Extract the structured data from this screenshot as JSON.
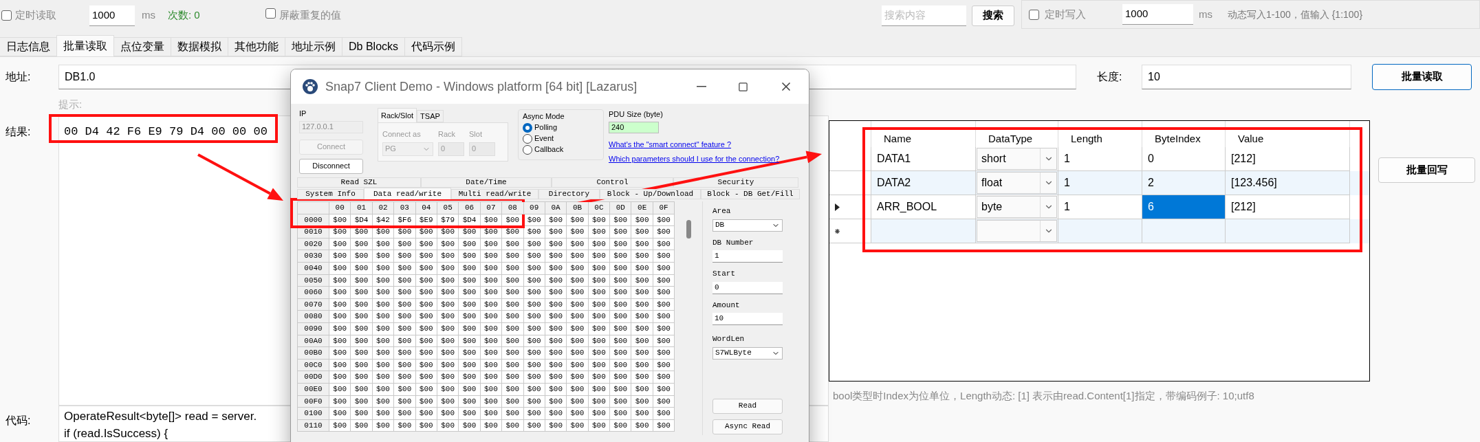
{
  "top_bar": {
    "timed_read": {
      "label": "定时读取",
      "checked": false
    },
    "interval": "1000",
    "interval_unit": "ms",
    "count": "次数: 0",
    "hide_duplicates": {
      "label": "屏蔽重复的值",
      "checked": false
    },
    "search": {
      "placeholder": "搜索内容"
    },
    "search_button": "搜索"
  },
  "write_panel": {
    "timed_write": {
      "label": "定时写入",
      "checked": false
    },
    "interval": "1000",
    "interval_unit": "ms",
    "hint": "动态写入1-100，值输入 {1:100}"
  },
  "tabs": [
    {
      "label": "日志信息",
      "selected": false
    },
    {
      "label": "批量读取",
      "selected": true
    },
    {
      "label": "点位变量",
      "selected": false
    },
    {
      "label": "数据模拟",
      "selected": false
    },
    {
      "label": "其他功能",
      "selected": false
    },
    {
      "label": "地址示例",
      "selected": false
    },
    {
      "label": "Db Blocks",
      "selected": false
    },
    {
      "label": "代码示例",
      "selected": false
    }
  ],
  "address": {
    "label": "地址:",
    "value": "DB1.0"
  },
  "length": {
    "label": "长度:",
    "value": "10"
  },
  "read_button": "批量读取",
  "tip_label": "提示:",
  "result": {
    "label": "结果:",
    "value": "00 D4 42 F6 E9 79 D4 00 00 00"
  },
  "batch_grid": {
    "columns": [
      {
        "label": "Name",
        "kind": "text"
      },
      {
        "label": "DataType",
        "kind": "combo"
      },
      {
        "label": "Length",
        "kind": "text"
      },
      {
        "label": "ByteIndex",
        "kind": "text"
      },
      {
        "label": "Value",
        "kind": "text"
      }
    ],
    "rows": [
      {
        "kind": "data",
        "current": false,
        "cells": [
          {
            "text": "DATA1",
            "selected": false
          },
          {
            "text": "short",
            "selected": false
          },
          {
            "text": "1",
            "selected": false
          },
          {
            "text": "0",
            "selected": false
          },
          {
            "text": "[212]",
            "selected": false
          }
        ]
      },
      {
        "kind": "data",
        "current": false,
        "cells": [
          {
            "text": "DATA2",
            "selected": false
          },
          {
            "text": "float",
            "selected": false
          },
          {
            "text": "1",
            "selected": false
          },
          {
            "text": "2",
            "selected": false
          },
          {
            "text": "[123.456]",
            "selected": false
          }
        ]
      },
      {
        "kind": "data",
        "current": true,
        "cells": [
          {
            "text": "ARR_BOOL",
            "selected": false
          },
          {
            "text": "byte",
            "selected": false
          },
          {
            "text": "1",
            "selected": false
          },
          {
            "text": "6",
            "selected": true
          },
          {
            "text": "[212]",
            "selected": false
          }
        ]
      },
      {
        "kind": "new",
        "current": false
      }
    ]
  },
  "write_button": "批量回写",
  "grid_hint": "bool类型时Index为位单位，Length动态: [1] 表示由read.Content[1]指定，带编码例子: 10;utf8",
  "code": {
    "label": "代码:",
    "lines": [
      "OperateResult<byte[]> read = server.",
      "if (read.IsSuccess) {"
    ]
  },
  "snap7_window": {
    "title": "Snap7 Client Demo - Windows platform [64 bit] [Lazarus]",
    "ip": {
      "label": "IP",
      "value": "127.0.0.1"
    },
    "connect_button": {
      "label": "Connect",
      "disabled": true
    },
    "disconnect_button": {
      "label": "Disconnect",
      "disabled": false
    },
    "connection_tabs": [
      {
        "label": "Rack/Slot",
        "selected": true
      },
      {
        "label": "TSAP",
        "selected": false
      }
    ],
    "connect_as": {
      "label": "Connect as",
      "value": "PG"
    },
    "rack": {
      "label": "Rack",
      "value": "0"
    },
    "slot": {
      "label": "Slot",
      "value": "0"
    },
    "async_mode": {
      "title": "Async Mode",
      "options": [
        {
          "label": "Polling",
          "selected": true
        },
        {
          "label": "Event",
          "selected": false
        },
        {
          "label": "Callback",
          "selected": false
        }
      ]
    },
    "pdu_size": {
      "label": "PDU Size (byte)",
      "value": "240"
    },
    "links": [
      "What's the \"smart connect\" feature ?",
      "Which parameters should I use for the connection?"
    ],
    "back_tabs": [
      "Read SZL",
      "Date/Time",
      "Control",
      "Security"
    ],
    "front_tabs": [
      {
        "label": "System Info",
        "selected": false
      },
      {
        "label": "Data read/write",
        "selected": true
      },
      {
        "label": "Multi read/write",
        "selected": false
      },
      {
        "label": "Directory",
        "selected": false
      },
      {
        "label": "Block - Up/Download",
        "selected": false
      },
      {
        "label": "Block - DB Get/Fill",
        "selected": false
      }
    ],
    "hex_grid": {
      "columns": [
        "00",
        "01",
        "02",
        "03",
        "04",
        "05",
        "06",
        "07",
        "08",
        "09",
        "0A",
        "0B",
        "0C",
        "0D",
        "0E",
        "0F"
      ],
      "rows": [
        {
          "address": "0000",
          "cells": [
            "$00",
            "$D4",
            "$42",
            "$F6",
            "$E9",
            "$79",
            "$D4",
            "$00",
            "$00",
            "$00",
            "$00",
            "$00",
            "$00",
            "$00",
            "$00",
            "$00"
          ]
        },
        {
          "address": "0010",
          "cells": [
            "$00",
            "$00",
            "$00",
            "$00",
            "$00",
            "$00",
            "$00",
            "$00",
            "$00",
            "$00",
            "$00",
            "$00",
            "$00",
            "$00",
            "$00",
            "$00"
          ]
        },
        {
          "address": "0020",
          "cells": [
            "$00",
            "$00",
            "$00",
            "$00",
            "$00",
            "$00",
            "$00",
            "$00",
            "$00",
            "$00",
            "$00",
            "$00",
            "$00",
            "$00",
            "$00",
            "$00"
          ]
        },
        {
          "address": "0030",
          "cells": [
            "$00",
            "$00",
            "$00",
            "$00",
            "$00",
            "$00",
            "$00",
            "$00",
            "$00",
            "$00",
            "$00",
            "$00",
            "$00",
            "$00",
            "$00",
            "$00"
          ]
        },
        {
          "address": "0040",
          "cells": [
            "$00",
            "$00",
            "$00",
            "$00",
            "$00",
            "$00",
            "$00",
            "$00",
            "$00",
            "$00",
            "$00",
            "$00",
            "$00",
            "$00",
            "$00",
            "$00"
          ]
        },
        {
          "address": "0050",
          "cells": [
            "$00",
            "$00",
            "$00",
            "$00",
            "$00",
            "$00",
            "$00",
            "$00",
            "$00",
            "$00",
            "$00",
            "$00",
            "$00",
            "$00",
            "$00",
            "$00"
          ]
        },
        {
          "address": "0060",
          "cells": [
            "$00",
            "$00",
            "$00",
            "$00",
            "$00",
            "$00",
            "$00",
            "$00",
            "$00",
            "$00",
            "$00",
            "$00",
            "$00",
            "$00",
            "$00",
            "$00"
          ]
        },
        {
          "address": "0070",
          "cells": [
            "$00",
            "$00",
            "$00",
            "$00",
            "$00",
            "$00",
            "$00",
            "$00",
            "$00",
            "$00",
            "$00",
            "$00",
            "$00",
            "$00",
            "$00",
            "$00"
          ]
        },
        {
          "address": "0080",
          "cells": [
            "$00",
            "$00",
            "$00",
            "$00",
            "$00",
            "$00",
            "$00",
            "$00",
            "$00",
            "$00",
            "$00",
            "$00",
            "$00",
            "$00",
            "$00",
            "$00"
          ]
        },
        {
          "address": "0090",
          "cells": [
            "$00",
            "$00",
            "$00",
            "$00",
            "$00",
            "$00",
            "$00",
            "$00",
            "$00",
            "$00",
            "$00",
            "$00",
            "$00",
            "$00",
            "$00",
            "$00"
          ]
        },
        {
          "address": "00A0",
          "cells": [
            "$00",
            "$00",
            "$00",
            "$00",
            "$00",
            "$00",
            "$00",
            "$00",
            "$00",
            "$00",
            "$00",
            "$00",
            "$00",
            "$00",
            "$00",
            "$00"
          ]
        },
        {
          "address": "00B0",
          "cells": [
            "$00",
            "$00",
            "$00",
            "$00",
            "$00",
            "$00",
            "$00",
            "$00",
            "$00",
            "$00",
            "$00",
            "$00",
            "$00",
            "$00",
            "$00",
            "$00"
          ]
        },
        {
          "address": "00C0",
          "cells": [
            "$00",
            "$00",
            "$00",
            "$00",
            "$00",
            "$00",
            "$00",
            "$00",
            "$00",
            "$00",
            "$00",
            "$00",
            "$00",
            "$00",
            "$00",
            "$00"
          ]
        },
        {
          "address": "00D0",
          "cells": [
            "$00",
            "$00",
            "$00",
            "$00",
            "$00",
            "$00",
            "$00",
            "$00",
            "$00",
            "$00",
            "$00",
            "$00",
            "$00",
            "$00",
            "$00",
            "$00"
          ]
        },
        {
          "address": "00E0",
          "cells": [
            "$00",
            "$00",
            "$00",
            "$00",
            "$00",
            "$00",
            "$00",
            "$00",
            "$00",
            "$00",
            "$00",
            "$00",
            "$00",
            "$00",
            "$00",
            "$00"
          ]
        },
        {
          "address": "00F0",
          "cells": [
            "$00",
            "$00",
            "$00",
            "$00",
            "$00",
            "$00",
            "$00",
            "$00",
            "$00",
            "$00",
            "$00",
            "$00",
            "$00",
            "$00",
            "$00",
            "$00"
          ]
        },
        {
          "address": "0100",
          "cells": [
            "$00",
            "$00",
            "$00",
            "$00",
            "$00",
            "$00",
            "$00",
            "$00",
            "$00",
            "$00",
            "$00",
            "$00",
            "$00",
            "$00",
            "$00",
            "$00"
          ]
        },
        {
          "address": "0110",
          "cells": [
            "$00",
            "$00",
            "$00",
            "$00",
            "$00",
            "$00",
            "$00",
            "$00",
            "$00",
            "$00",
            "$00",
            "$00",
            "$00",
            "$00",
            "$00",
            "$00"
          ]
        }
      ]
    },
    "side_fields": [
      {
        "kind": "dropdown",
        "label": "Area",
        "value": "DB"
      },
      {
        "kind": "text",
        "label": "DB Number",
        "value": "1"
      },
      {
        "kind": "text",
        "label": "Start",
        "value": "0"
      },
      {
        "kind": "text",
        "label": "Amount",
        "value": "10"
      },
      {
        "kind": "dropdown",
        "label": "WordLen",
        "value": "S7WLByte"
      }
    ],
    "side_buttons": [
      "Read",
      "Async Read"
    ]
  }
}
